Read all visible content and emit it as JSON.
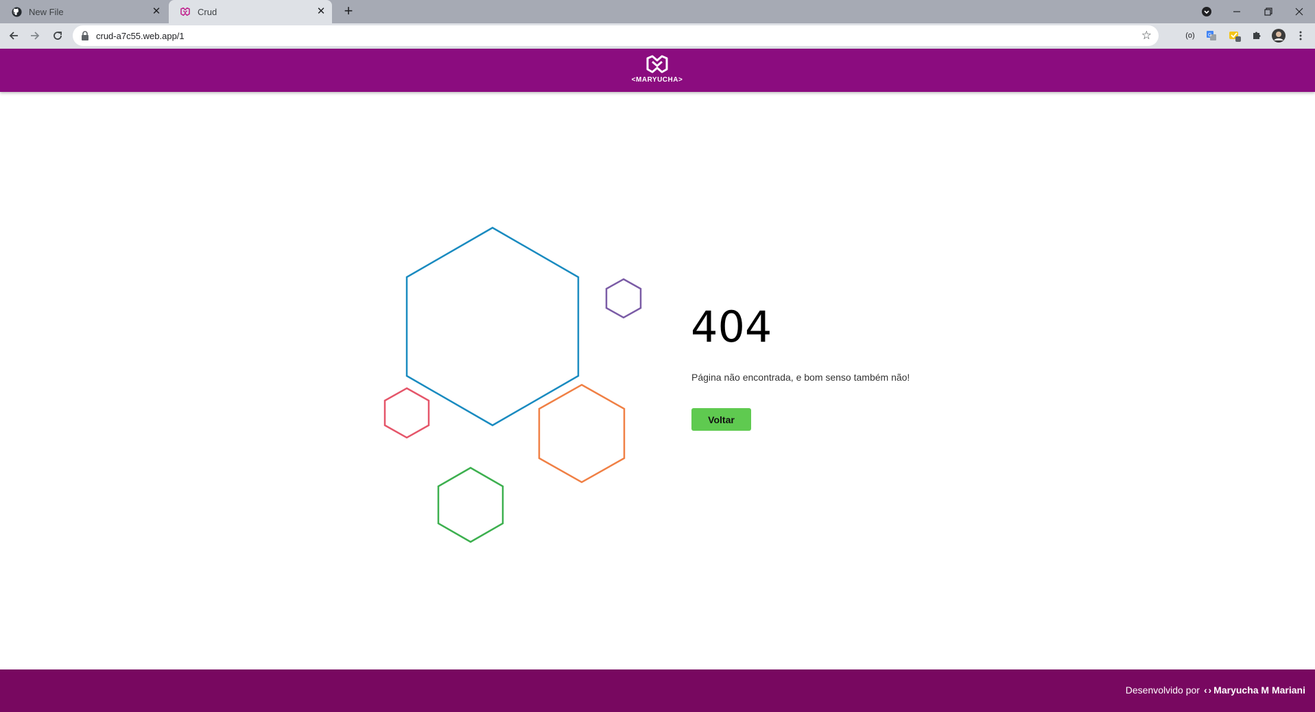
{
  "browser": {
    "tabs": [
      {
        "title": "New File",
        "icon": "github-icon"
      },
      {
        "title": "Crud",
        "icon": "maryucha-icon"
      }
    ],
    "url": "crud-a7c55.web.app/1"
  },
  "header": {
    "logo_text": "<MARYUCHA>"
  },
  "error": {
    "code": "404",
    "message": "Página não encontrada, e bom senso também não!",
    "back_label": "Voltar"
  },
  "footer": {
    "prefix": "Desenvolvido por",
    "code_icon": "‹ ›",
    "author": "Maryucha M Mariani"
  },
  "colors": {
    "header": "#8b0c7f",
    "footer": "#780860",
    "button": "#5fca50",
    "hex_blue": "#1a8bc0",
    "hex_purple": "#7b5ca6",
    "hex_red": "#e5566a",
    "hex_orange": "#f08045",
    "hex_green": "#3db04f"
  }
}
